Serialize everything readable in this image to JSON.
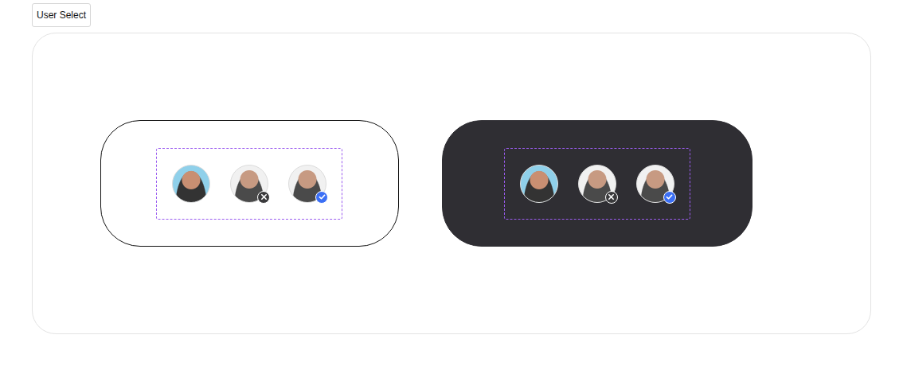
{
  "title": "User Select",
  "panels": [
    {
      "kind": "light",
      "avatars": [
        {
          "kind": "plain"
        },
        {
          "kind": "removed"
        },
        {
          "kind": "selected"
        }
      ]
    },
    {
      "kind": "dark",
      "avatars": [
        {
          "kind": "plain"
        },
        {
          "kind": "removed"
        },
        {
          "kind": "selected"
        }
      ]
    }
  ]
}
